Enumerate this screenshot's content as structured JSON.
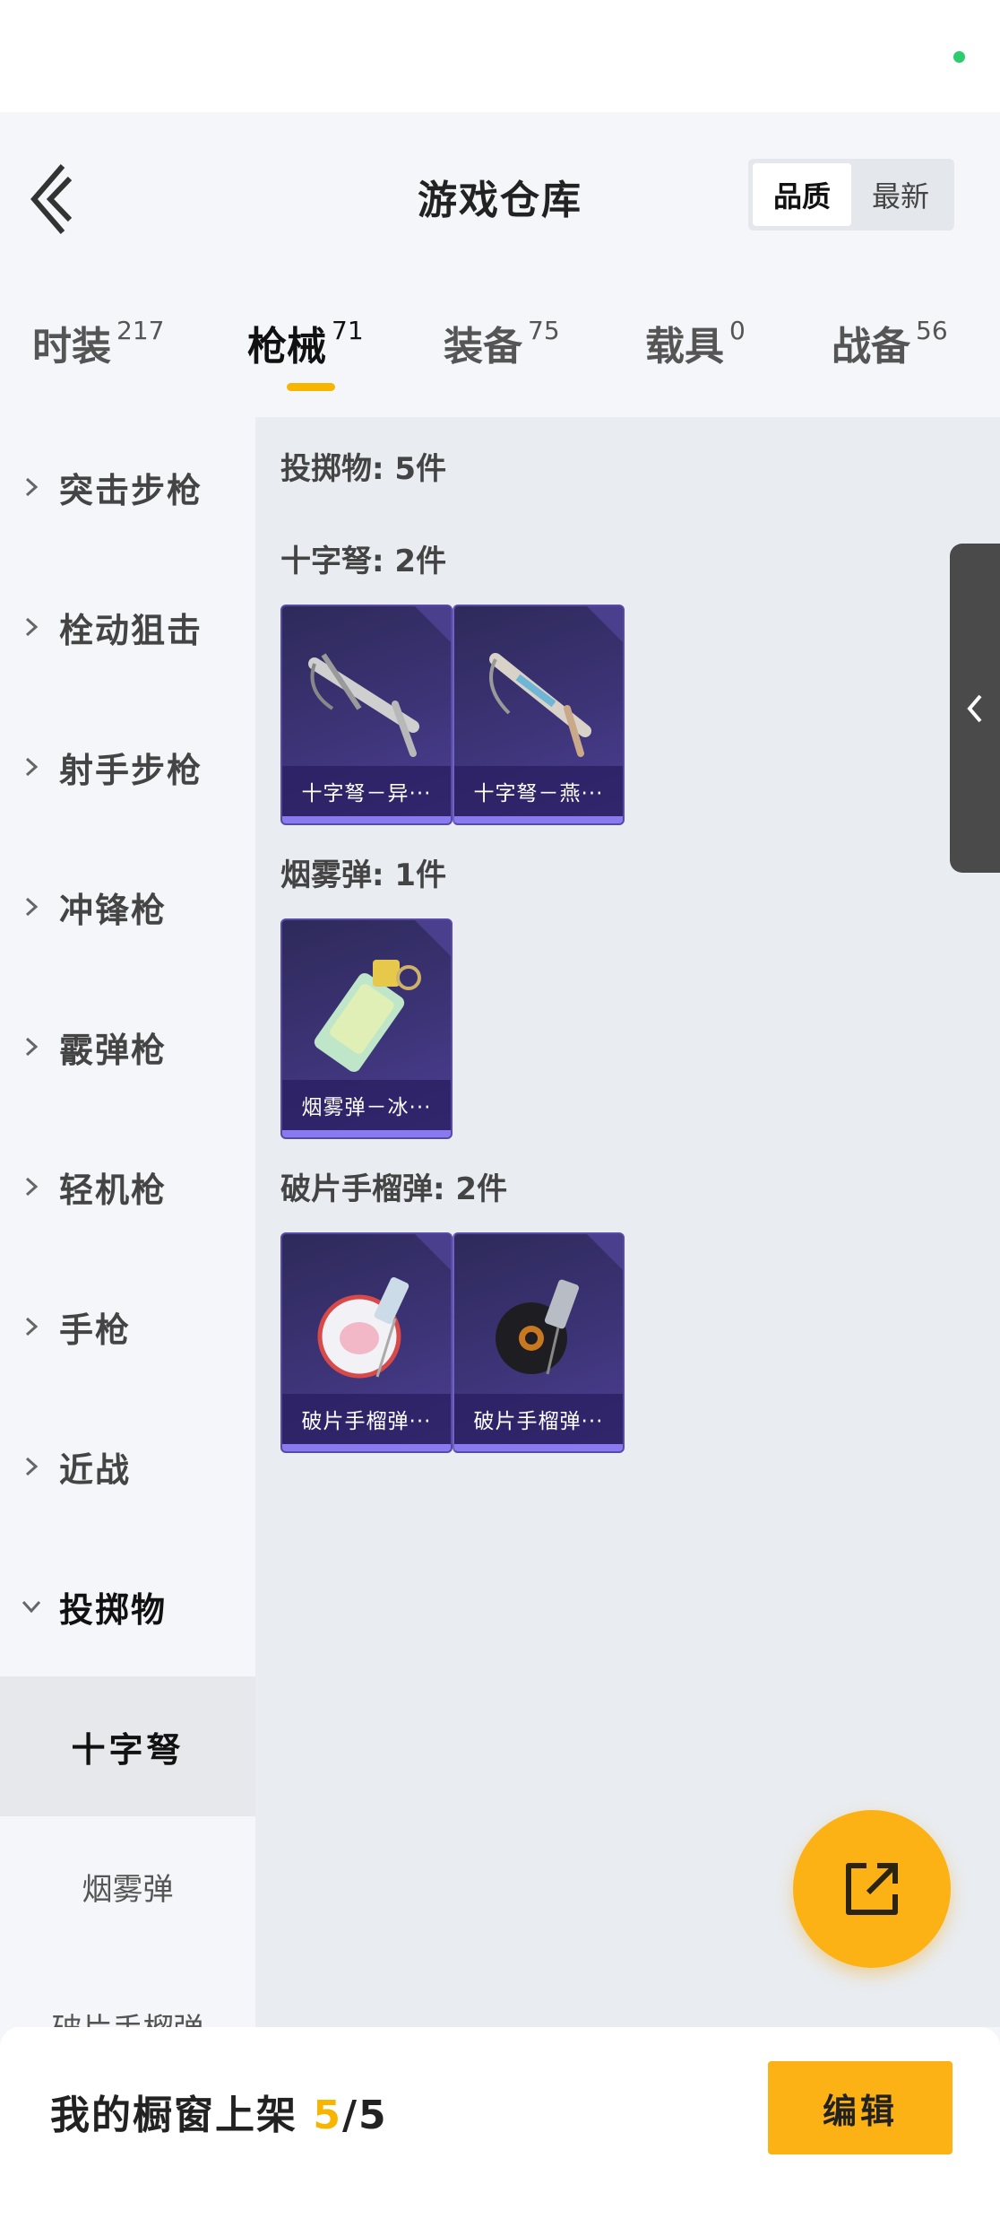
{
  "header": {
    "title": "游戏仓库",
    "sort_options": [
      "品质",
      "最新"
    ],
    "sort_selected": "品质"
  },
  "tabs": [
    {
      "label": "时装",
      "count": "217"
    },
    {
      "label": "枪械",
      "count": "71",
      "active": true
    },
    {
      "label": "装备",
      "count": "75"
    },
    {
      "label": "载具",
      "count": "0"
    },
    {
      "label": "战备",
      "count": "56"
    }
  ],
  "sidebar": {
    "categories": [
      "突击步枪",
      "栓动狙击",
      "射手步枪",
      "冲锋枪",
      "霰弹枪",
      "轻机枪",
      "手枪",
      "近战",
      "投掷物"
    ],
    "expanded": "投掷物",
    "subcategories": [
      "十字弩",
      "烟雾弹",
      "破片手榴弹"
    ],
    "sub_selected": "十字弩"
  },
  "content": {
    "group_title": "投掷物: 5件",
    "sections": [
      {
        "title": "十字弩: 2件",
        "items": [
          {
            "name": "十字弩－异···",
            "icon": "crossbow-icon"
          },
          {
            "name": "十字弩－燕···",
            "icon": "crossbow-icon"
          }
        ]
      },
      {
        "title": "烟雾弹: 1件",
        "items": [
          {
            "name": "烟雾弹－冰···",
            "icon": "smoke-grenade-icon"
          }
        ]
      },
      {
        "title": "破片手榴弹: 2件",
        "items": [
          {
            "name": "破片手榴弹···",
            "icon": "frag-grenade-icon"
          },
          {
            "name": "破片手榴弹···",
            "icon": "frag-grenade-icon"
          }
        ]
      }
    ]
  },
  "bottom_bar": {
    "label": "我的橱窗上架",
    "current": "5",
    "total": "/5",
    "edit_label": "编辑"
  },
  "colors": {
    "accent": "#fcb214",
    "card_purple": "#3d3478",
    "status_dot": "#2ecc71"
  }
}
